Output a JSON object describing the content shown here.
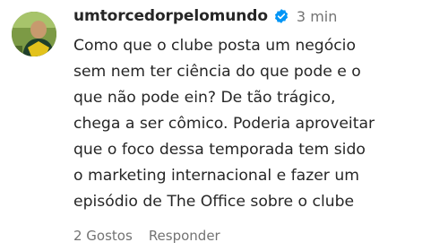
{
  "comment": {
    "username": "umtorcedorpelomundo",
    "verified_icon": "verified-badge-icon",
    "time": "3 min",
    "avatar_icon": "avatar-photo",
    "text_lines": [
      "Como que o clube posta um negócio",
      "sem nem ter ciência do que pode e o",
      "que não pode ein? De tão trágico,",
      "chega a ser cômico. Poderia aproveitar",
      "que o foco dessa temporada tem sido",
      "o marketing internacional e fazer um",
      "episódio de The Office sobre o clube"
    ],
    "likes_label": "2 Gostos",
    "reply_label": "Responder"
  },
  "colors": {
    "text_primary": "#262626",
    "text_secondary": "#737373",
    "verified_blue": "#0095f6"
  }
}
